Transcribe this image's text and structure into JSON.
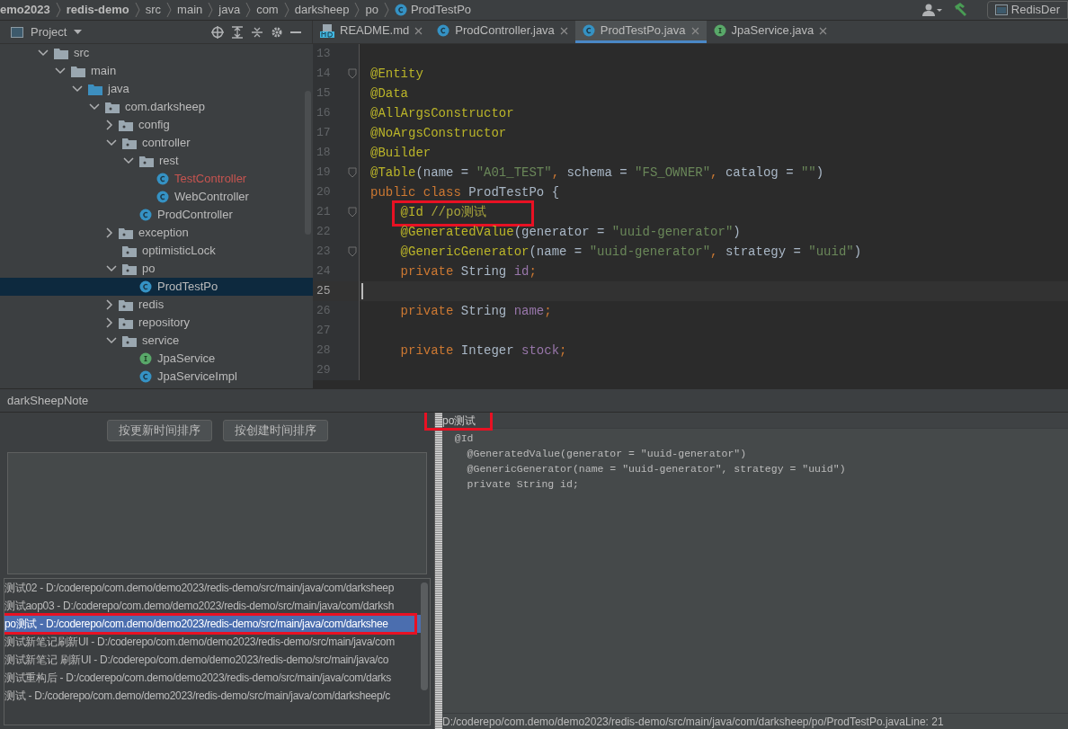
{
  "breadcrumb": [
    {
      "label": "emo2023",
      "bold": true
    },
    {
      "label": "redis-demo",
      "bold": true
    },
    {
      "label": "src",
      "bold": false
    },
    {
      "label": "main",
      "bold": false
    },
    {
      "label": "java",
      "bold": false
    },
    {
      "label": "com",
      "bold": false
    },
    {
      "label": "darksheep",
      "bold": false
    },
    {
      "label": "po",
      "bold": false
    },
    {
      "label": "ProdTestPo",
      "bold": false,
      "kind": "class"
    }
  ],
  "run_config": "RedisDer",
  "project_panel": {
    "title": "Project"
  },
  "tabs": [
    {
      "label": "README.md",
      "kind": "markdown",
      "selected": false
    },
    {
      "label": "ProdController.java",
      "kind": "class",
      "selected": false
    },
    {
      "label": "ProdTestPo.java",
      "kind": "class",
      "selected": true
    },
    {
      "label": "JpaService.java",
      "kind": "interface",
      "selected": false
    }
  ],
  "tree": [
    {
      "label": "src",
      "kind": "folder",
      "expanded": true,
      "selected": false,
      "children": [
        {
          "label": "main",
          "kind": "folder",
          "expanded": true,
          "selected": false,
          "children": [
            {
              "label": "java",
              "kind": "source",
              "expanded": true,
              "selected": false,
              "children": [
                {
                  "label": "com.darksheep",
                  "kind": "package",
                  "expanded": true,
                  "selected": false,
                  "children": [
                    {
                      "label": "config",
                      "kind": "package",
                      "expanded": false,
                      "selected": false
                    },
                    {
                      "label": "controller",
                      "kind": "package",
                      "expanded": true,
                      "selected": false,
                      "children": [
                        {
                          "label": "rest",
                          "kind": "package",
                          "expanded": true,
                          "selected": false,
                          "children": [
                            {
                              "label": "TestController",
                              "kind": "class",
                              "modified": true,
                              "selected": false
                            },
                            {
                              "label": "WebController",
                              "kind": "class",
                              "modified": false,
                              "selected": false
                            }
                          ]
                        },
                        {
                          "label": "ProdController",
                          "kind": "class",
                          "modified": false,
                          "selected": false
                        }
                      ]
                    },
                    {
                      "label": "exception",
                      "kind": "package",
                      "expanded": false,
                      "selected": false
                    },
                    {
                      "label": "optimisticLock",
                      "kind": "package",
                      "selected": false
                    },
                    {
                      "label": "po",
                      "kind": "package",
                      "expanded": true,
                      "selected": false,
                      "children": [
                        {
                          "label": "ProdTestPo",
                          "kind": "class",
                          "modified": false,
                          "selected": true
                        }
                      ]
                    },
                    {
                      "label": "redis",
                      "kind": "package",
                      "expanded": false,
                      "selected": false
                    },
                    {
                      "label": "repository",
                      "kind": "package",
                      "expanded": false,
                      "selected": false
                    },
                    {
                      "label": "service",
                      "kind": "package",
                      "expanded": true,
                      "selected": false,
                      "children": [
                        {
                          "label": "JpaService",
                          "kind": "interface",
                          "modified": false,
                          "selected": false
                        },
                        {
                          "label": "JpaServiceImpl",
                          "kind": "class",
                          "modified": false,
                          "selected": false
                        }
                      ]
                    }
                  ]
                }
              ]
            }
          ]
        }
      ]
    }
  ],
  "code": [
    {
      "number": "13",
      "fold": false,
      "current": false,
      "highlighted": false
    },
    {
      "number": "14",
      "fold": true,
      "current": false,
      "highlighted": false,
      "tokens": [
        {
          "text": "@Entity",
          "kind": "annotation"
        }
      ]
    },
    {
      "number": "15",
      "fold": false,
      "current": false,
      "highlighted": false,
      "tokens": [
        {
          "text": "@Data",
          "kind": "annotation"
        }
      ]
    },
    {
      "number": "16",
      "fold": false,
      "current": false,
      "highlighted": false,
      "tokens": [
        {
          "text": "@AllArgsConstructor",
          "kind": "annotation"
        }
      ]
    },
    {
      "number": "17",
      "fold": false,
      "current": false,
      "highlighted": false,
      "tokens": [
        {
          "text": "@NoArgsConstructor",
          "kind": "annotation"
        }
      ]
    },
    {
      "number": "18",
      "fold": false,
      "current": false,
      "highlighted": false,
      "tokens": [
        {
          "text": "@Builder",
          "kind": "annotation"
        }
      ]
    },
    {
      "number": "19",
      "fold": true,
      "current": false,
      "highlighted": false,
      "tokens": [
        {
          "text": "@Table",
          "kind": "annotation"
        },
        {
          "text": "(name = ",
          "kind": "plain"
        },
        {
          "text": "\"A01_TEST\"",
          "kind": "string"
        },
        {
          "text": ", ",
          "kind": "keyword"
        },
        {
          "text": "schema = ",
          "kind": "plain"
        },
        {
          "text": "\"FS_OWNER\"",
          "kind": "string"
        },
        {
          "text": ", ",
          "kind": "keyword"
        },
        {
          "text": "catalog = ",
          "kind": "plain"
        },
        {
          "text": "\"\"",
          "kind": "string"
        },
        {
          "text": ")",
          "kind": "plain"
        }
      ]
    },
    {
      "number": "20",
      "fold": false,
      "current": false,
      "highlighted": false,
      "tokens": [
        {
          "text": "public class ",
          "kind": "keyword"
        },
        {
          "text": "ProdTestPo {",
          "kind": "plain"
        }
      ]
    },
    {
      "number": "21",
      "fold": true,
      "current": false,
      "highlighted": true,
      "tokens": [
        {
          "text": "    @Id ",
          "kind": "annotation"
        },
        {
          "text": "//po测试",
          "kind": "comment"
        }
      ]
    },
    {
      "number": "22",
      "fold": false,
      "current": false,
      "highlighted": false,
      "tokens": [
        {
          "text": "    @GeneratedValue",
          "kind": "annotation"
        },
        {
          "text": "(generator = ",
          "kind": "plain"
        },
        {
          "text": "\"uuid-generator\"",
          "kind": "string"
        },
        {
          "text": ")",
          "kind": "plain"
        }
      ]
    },
    {
      "number": "23",
      "fold": true,
      "current": false,
      "highlighted": false,
      "tokens": [
        {
          "text": "    @GenericGenerator",
          "kind": "annotation"
        },
        {
          "text": "(name = ",
          "kind": "plain"
        },
        {
          "text": "\"uuid-generator\"",
          "kind": "string"
        },
        {
          "text": ", ",
          "kind": "keyword"
        },
        {
          "text": "strategy = ",
          "kind": "plain"
        },
        {
          "text": "\"uuid\"",
          "kind": "string"
        },
        {
          "text": ")",
          "kind": "plain"
        }
      ]
    },
    {
      "number": "24",
      "fold": false,
      "current": false,
      "highlighted": false,
      "tokens": [
        {
          "text": "    private ",
          "kind": "keyword"
        },
        {
          "text": "String ",
          "kind": "plain"
        },
        {
          "text": "id",
          "kind": "field"
        },
        {
          "text": ";",
          "kind": "keyword"
        }
      ]
    },
    {
      "number": "25",
      "fold": false,
      "current": true,
      "highlighted": false
    },
    {
      "number": "26",
      "fold": false,
      "current": false,
      "highlighted": false,
      "tokens": [
        {
          "text": "    private ",
          "kind": "keyword"
        },
        {
          "text": "String ",
          "kind": "plain"
        },
        {
          "text": "name",
          "kind": "field"
        },
        {
          "text": ";",
          "kind": "keyword"
        }
      ]
    },
    {
      "number": "27",
      "fold": false,
      "current": false,
      "highlighted": false
    },
    {
      "number": "28",
      "fold": false,
      "current": false,
      "highlighted": false,
      "tokens": [
        {
          "text": "    private ",
          "kind": "keyword"
        },
        {
          "text": "Integer ",
          "kind": "plain"
        },
        {
          "text": "stock",
          "kind": "field"
        },
        {
          "text": ";",
          "kind": "keyword"
        }
      ]
    },
    {
      "number": "29",
      "fold": false,
      "current": false,
      "highlighted": false
    }
  ],
  "note_panel": {
    "title": "darkSheepNote",
    "buttons": [
      "按更新时间排序",
      "按创建时间排序"
    ],
    "notes": [
      {
        "text": "测试02 - D:/coderepo/com.demo/demo2023/redis-demo/src/main/java/com/darksheep",
        "selected": false,
        "highlighted": false
      },
      {
        "text": "测试aop03 - D:/coderepo/com.demo/demo2023/redis-demo/src/main/java/com/darksh",
        "selected": false,
        "highlighted": false
      },
      {
        "text": "po测试 - D:/coderepo/com.demo/demo2023/redis-demo/src/main/java/com/darkshee",
        "selected": true,
        "highlighted": true
      },
      {
        "text": "测试新笔记刷新UI - D:/coderepo/com.demo/demo2023/redis-demo/src/main/java/com",
        "selected": false,
        "highlighted": false
      },
      {
        "text": "测试新笔记 刷新UI - D:/coderepo/com.demo/demo2023/redis-demo/src/main/java/co",
        "selected": false,
        "highlighted": false
      },
      {
        "text": "测试重构后 - D:/coderepo/com.demo/demo2023/redis-demo/src/main/java/com/darks",
        "selected": false,
        "highlighted": false
      },
      {
        "text": "测试 - D:/coderepo/com.demo/demo2023/redis-demo/src/main/java/com/darksheep/c",
        "selected": false,
        "highlighted": false
      }
    ],
    "preview": {
      "title": "po测试",
      "title_highlighted": true,
      "lines": [
        "  @Id",
        "    @GeneratedValue(generator = \"uuid-generator\")",
        "    @GenericGenerator(name = \"uuid-generator\", strategy = \"uuid\")",
        "    private String id;"
      ],
      "status": "D:/coderepo/com.demo/demo2023/redis-demo/src/main/java/com/darksheep/po/ProdTestPo.javaLine: 21"
    }
  }
}
